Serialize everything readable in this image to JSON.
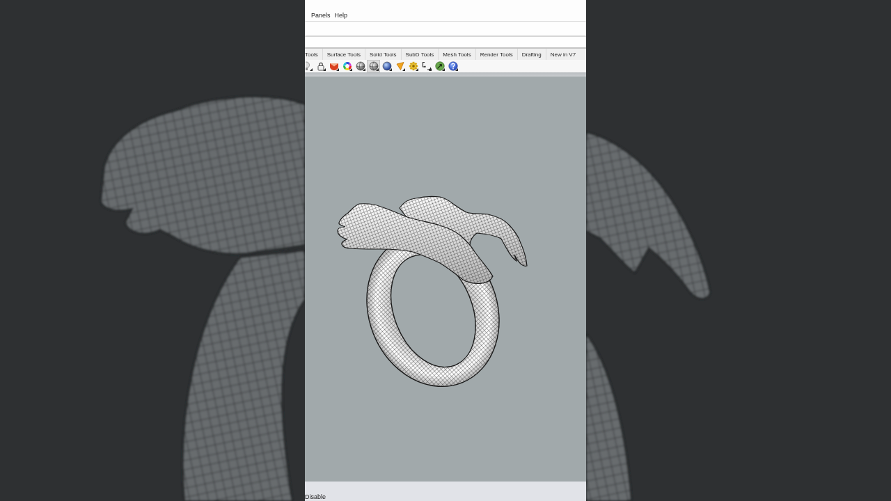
{
  "menu_bar": {
    "items": [
      "Panels",
      "Help"
    ]
  },
  "tabs": [
    {
      "label": "Tools",
      "selected": false
    },
    {
      "label": "Surface Tools",
      "selected": false
    },
    {
      "label": "Solid Tools",
      "selected": false
    },
    {
      "label": "SubD Tools",
      "selected": false
    },
    {
      "label": "Mesh Tools",
      "selected": false
    },
    {
      "label": "Render Tools",
      "selected": false
    },
    {
      "label": "Drafting",
      "selected": false
    },
    {
      "label": "New in V7",
      "selected": false
    }
  ],
  "toolbar": {
    "buttons": [
      {
        "pressed": false
      },
      {
        "pressed": false
      },
      {
        "pressed": false
      },
      {
        "pressed": false
      },
      {
        "pressed": false
      },
      {
        "pressed": true
      },
      {
        "pressed": false
      },
      {
        "pressed": false
      },
      {
        "pressed": false
      },
      {
        "pressed": false
      },
      {
        "pressed": false
      },
      {
        "pressed": false
      }
    ]
  },
  "status_bar": {
    "text": "Disable"
  }
}
